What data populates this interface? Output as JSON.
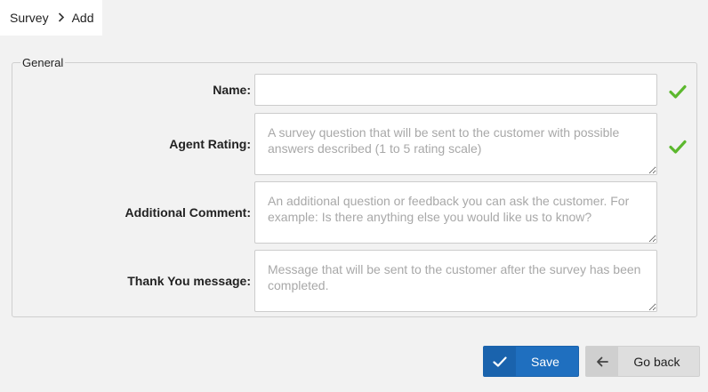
{
  "breadcrumb": {
    "root": "Survey",
    "current": "Add"
  },
  "form": {
    "legend": "General",
    "fields": [
      {
        "label": "Name:",
        "value": "",
        "placeholder": "",
        "valid": true
      },
      {
        "label": "Agent Rating:",
        "value": "",
        "placeholder": "A survey question that will be sent to the customer with possible answers described (1 to 5 rating scale)",
        "valid": true
      },
      {
        "label": "Additional Comment:",
        "value": "",
        "placeholder": "An additional question or feedback you can ask the customer. For example: Is there anything else you would like us to know?",
        "valid": false
      },
      {
        "label": "Thank You message:",
        "value": "",
        "placeholder": "Message that will be sent to the customer after the survey has been completed.",
        "valid": false
      }
    ]
  },
  "actions": {
    "save_label": "Save",
    "back_label": "Go back"
  },
  "icons": {
    "valid": "check-icon",
    "save": "check-icon",
    "back": "arrow-left-icon",
    "breadcrumb_sep": "chevron-right-icon"
  },
  "colors": {
    "primary": "#1f6fbf",
    "success": "#5cb82e",
    "secondary": "#dedede"
  }
}
